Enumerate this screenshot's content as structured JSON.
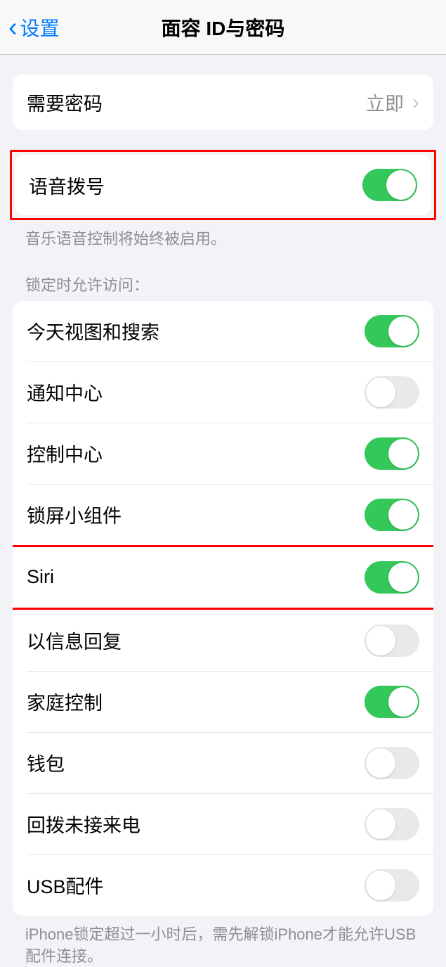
{
  "header": {
    "back_label": "设置",
    "title": "面容 ID与密码"
  },
  "require_passcode": {
    "label": "需要密码",
    "value": "立即"
  },
  "voice_dial": {
    "label": "语音拨号",
    "on": true,
    "footer": "音乐语音控制将始终被启用。"
  },
  "allow_access_header": "锁定时允许访问：",
  "allow_access": [
    {
      "label": "今天视图和搜索",
      "on": true
    },
    {
      "label": "通知中心",
      "on": false
    },
    {
      "label": "控制中心",
      "on": true
    },
    {
      "label": "锁屏小组件",
      "on": true
    },
    {
      "label": "Siri",
      "on": true
    },
    {
      "label": "以信息回复",
      "on": false
    },
    {
      "label": "家庭控制",
      "on": true
    },
    {
      "label": "钱包",
      "on": false
    },
    {
      "label": "回拨未接来电",
      "on": false
    },
    {
      "label": "USB配件",
      "on": false
    }
  ],
  "usb_footer": "iPhone锁定超过一小时后，需先解锁iPhone才能允许USB配件连接。",
  "highlighted_rows": [
    0,
    5
  ]
}
